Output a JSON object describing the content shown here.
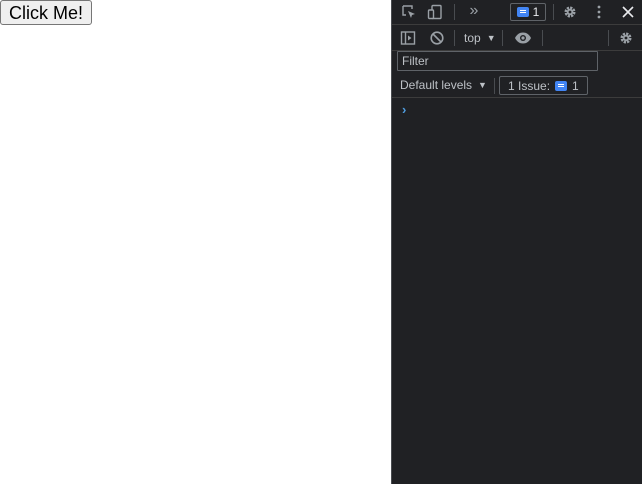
{
  "page": {
    "button_label": "Click Me!"
  },
  "devtools": {
    "top_bar": {
      "more_tabs_glyph": "»",
      "issues_count": "1",
      "icons": [
        "inspect-icon",
        "device-toolbar-icon",
        "more-tabs-icon",
        "issues-icon",
        "gear-icon",
        "kebab-menu-icon",
        "close-icon"
      ]
    },
    "console_toolbar": {
      "context": "top",
      "icons": [
        "sidebar-toggle-icon",
        "clear-console-icon",
        "eye-icon",
        "gear-icon"
      ]
    },
    "filter": {
      "placeholder": "Filter"
    },
    "levels": {
      "label": "Default levels",
      "issue_label": "1 Issue:",
      "issue_count": "1"
    },
    "prompt_glyph": "›",
    "colors": {
      "background": "#202124",
      "accent": "#4285f4",
      "text": "#bdc1c6"
    }
  }
}
